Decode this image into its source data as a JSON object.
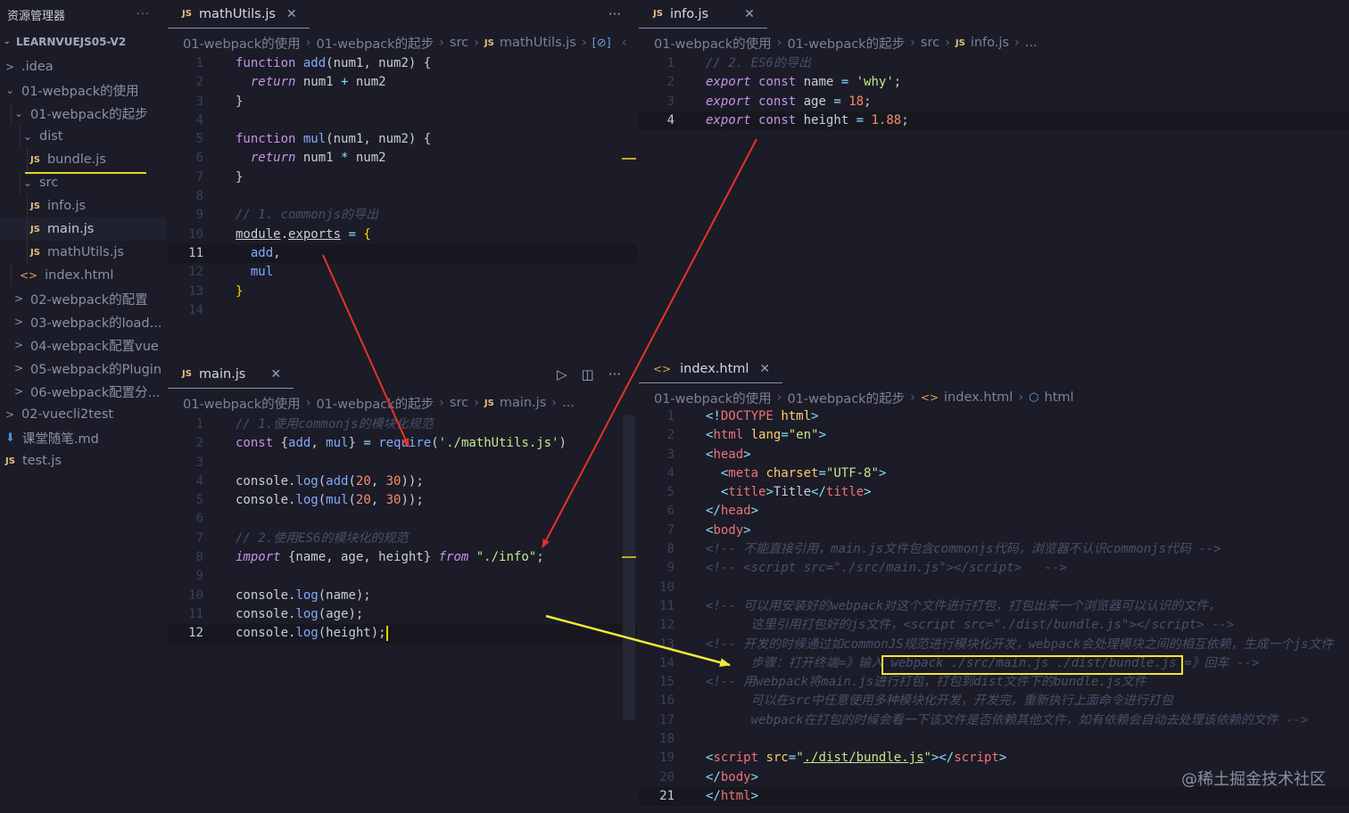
{
  "sidebar": {
    "title": "资源管理器",
    "more": "···",
    "root": "LEARNVUEJS05-V2",
    "items": [
      {
        "label": ".idea",
        "caret": ">"
      },
      {
        "label": "01-webpack的使用",
        "caret": "⌄"
      },
      {
        "label": "01-webpack的起步",
        "caret": "⌄"
      },
      {
        "label": "dist",
        "caret": "⌄"
      },
      {
        "label": "bundle.js",
        "icon": "JS"
      },
      {
        "label": "src",
        "caret": "⌄"
      },
      {
        "label": "info.js",
        "icon": "JS"
      },
      {
        "label": "main.js",
        "icon": "JS"
      },
      {
        "label": "mathUtils.js",
        "icon": "JS"
      },
      {
        "label": "index.html",
        "icon": "<>"
      },
      {
        "label": "02-webpack的配置",
        "caret": ">"
      },
      {
        "label": "03-webpack的load...",
        "caret": ">"
      },
      {
        "label": "04-webpack配置vue",
        "caret": ">"
      },
      {
        "label": "05-webpack的Plugin",
        "caret": ">"
      },
      {
        "label": "06-webpack配置分...",
        "caret": ">"
      },
      {
        "label": "02-vuecli2test",
        "caret": ">"
      },
      {
        "label": "课堂随笔.md",
        "icon": "⬇"
      },
      {
        "label": "test.js",
        "icon": "JS"
      }
    ]
  },
  "panes": {
    "mathUtils": {
      "tab": "mathUtils.js",
      "more": "···",
      "crumbs": [
        "01-webpack的使用",
        "01-webpack的起步",
        "src",
        "mathUtils.js"
      ]
    },
    "info": {
      "tab": "info.js",
      "crumbs": [
        "01-webpack的使用",
        "01-webpack的起步",
        "src",
        "info.js",
        "..."
      ]
    },
    "main": {
      "tab": "main.js",
      "more": "···",
      "crumbs": [
        "01-webpack的使用",
        "01-webpack的起步",
        "src",
        "main.js",
        "..."
      ]
    },
    "index": {
      "tab": "index.html",
      "crumbs": [
        "01-webpack的使用",
        "01-webpack的起步",
        "index.html",
        "html"
      ]
    }
  },
  "icons": {
    "close": "close-icon",
    "run": "play-icon",
    "split": "split-editor-icon",
    "file_js": "js-file-icon",
    "file_html": "html-file-icon"
  },
  "colors": {
    "background": "#1b1c27",
    "keyword": "#c792ea",
    "function": "#82aaff",
    "string": "#c3e88d",
    "number": "#f78c6c",
    "highlight_box": "#f4e23a",
    "arrow_red": "#e8322b",
    "arrow_yellow": "#f0e83a"
  },
  "watermark": "@稀土掘金技术社区"
}
